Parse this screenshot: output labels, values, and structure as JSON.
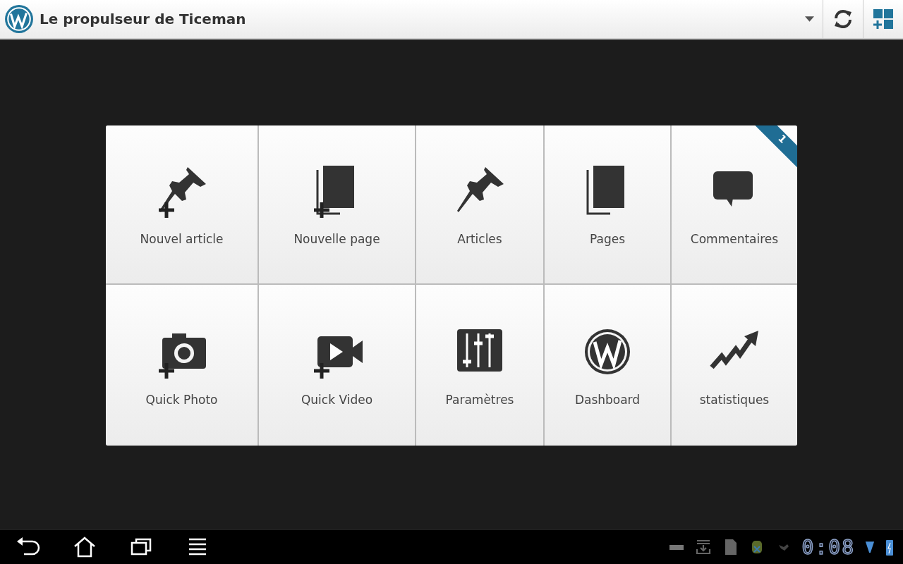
{
  "header": {
    "title": "Le propulseur de Ticeman"
  },
  "tiles": [
    {
      "label": "Nouvel article",
      "kind": "pin",
      "plus": true
    },
    {
      "label": "Nouvelle page",
      "kind": "page",
      "plus": true
    },
    {
      "label": "Articles",
      "kind": "pin",
      "plus": false
    },
    {
      "label": "Pages",
      "kind": "page",
      "plus": false
    },
    {
      "label": "Commentaires",
      "kind": "comment",
      "plus": false,
      "badge": "1"
    },
    {
      "label": "Quick Photo",
      "kind": "camera",
      "plus": true
    },
    {
      "label": "Quick Video",
      "kind": "video",
      "plus": true
    },
    {
      "label": "Paramètres",
      "kind": "sliders",
      "plus": false
    },
    {
      "label": "Dashboard",
      "kind": "wp",
      "plus": false
    },
    {
      "label": "statistiques",
      "kind": "stats",
      "plus": false
    }
  ],
  "status_bar": {
    "clock": "0:08"
  }
}
